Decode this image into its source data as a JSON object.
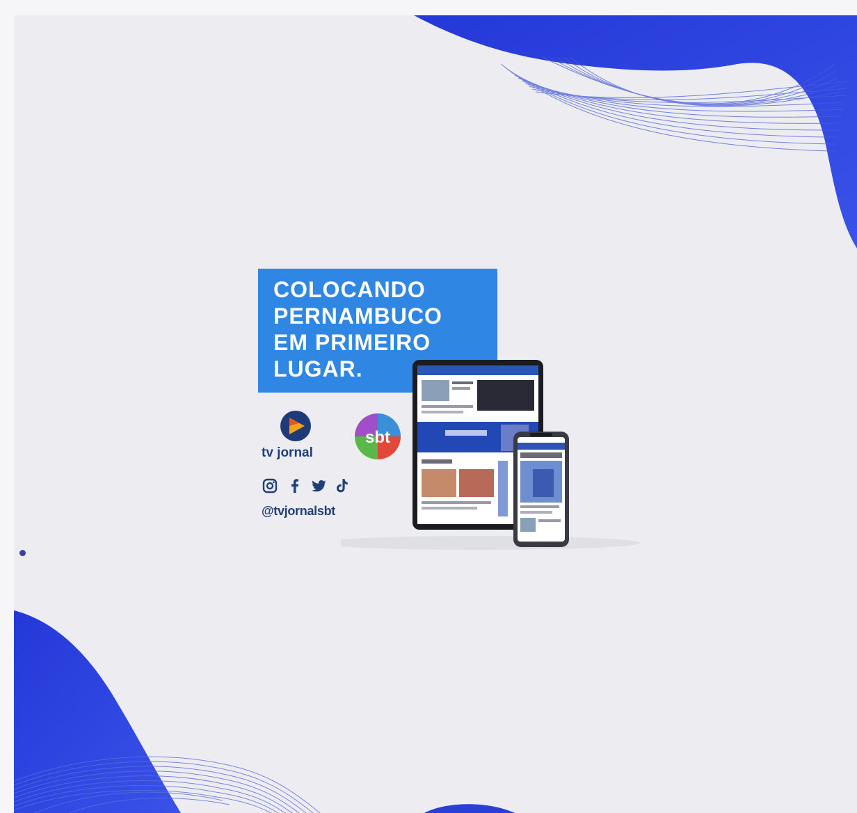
{
  "headline": {
    "lines": [
      "COLOCANDO",
      "PERNAMBUCO",
      "EM PRIMEIRO",
      "LUGAR."
    ]
  },
  "brand": {
    "tv_jornal": "tv jornal",
    "sbt": "sbt",
    "handle": "@tvjornalsbt"
  },
  "social_icons": [
    "instagram-icon",
    "facebook-icon",
    "twitter-icon",
    "tiktok-icon"
  ],
  "colors": {
    "background": "#ececf1",
    "headline_box": "#2f86e3",
    "wave_blue": "#2a3fd6",
    "brand_text": "#1f3f78"
  }
}
